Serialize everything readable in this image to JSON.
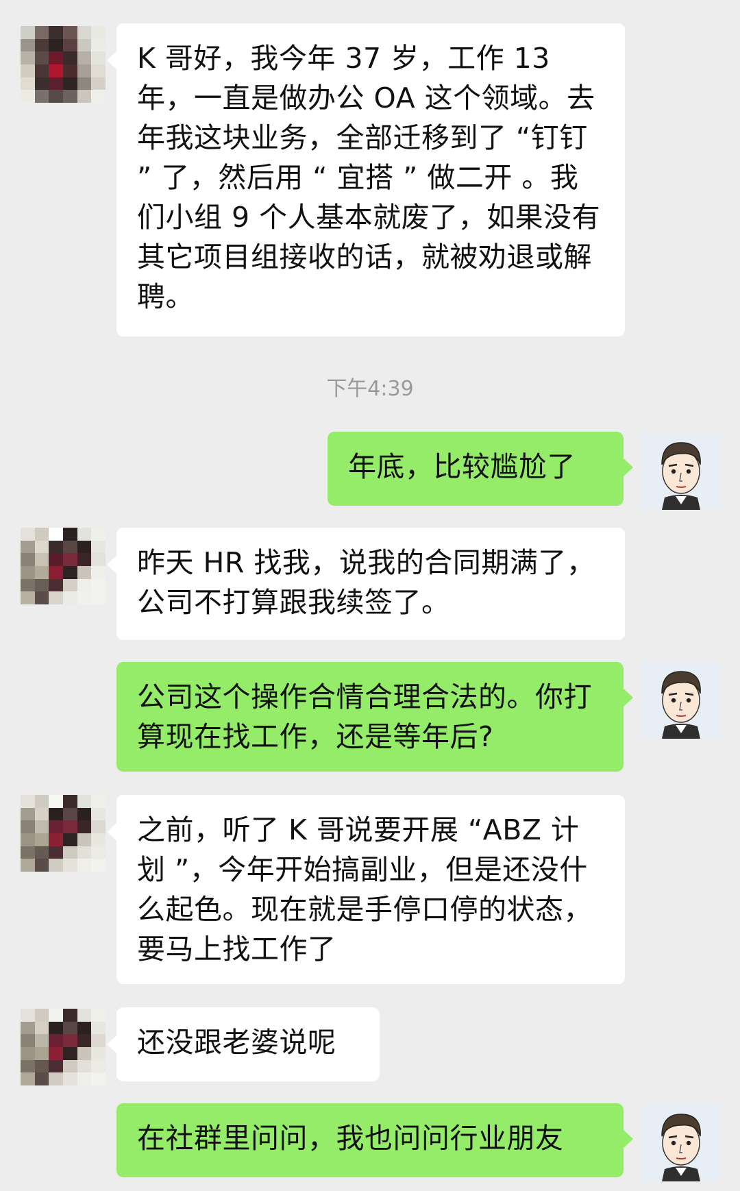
{
  "chat": {
    "timestamp": "下午4:39",
    "messages": [
      {
        "side": "left",
        "text": "K 哥好，我今年 37 岁，工作 13 年，一直是做办公 OA 这个领域。去年我这块业务，全部迁移到了 “钉钉 ” 了，然后用 “ 宜搭 ” 做二开 。我们小组 9 个人基本就废了，如果没有其它项目组接收的话，就被劝退或解聘。"
      },
      {
        "side": "right",
        "text": "年底，比较尴尬了"
      },
      {
        "side": "left",
        "text": "昨天 HR 找我，说我的合同期满了，公司不打算跟我续签了。"
      },
      {
        "side": "right",
        "text": "公司这个操作合情合理合法的。你打算现在找工作，还是等年后?"
      },
      {
        "side": "left",
        "text": "之前，听了 K 哥说要开展 “ABZ 计划 ”，今年开始搞副业，但是还没什么起色。现在就是手停口停的状态，要马上找工作了"
      },
      {
        "side": "left",
        "text": "还没跟老婆说呢"
      },
      {
        "side": "right",
        "text": "在社群里问问，我也问问行业朋友"
      }
    ]
  },
  "colors": {
    "background": "#ededed",
    "bubble_left": "#ffffff",
    "bubble_right": "#95ec69",
    "timestamp": "#9a9a9a"
  }
}
